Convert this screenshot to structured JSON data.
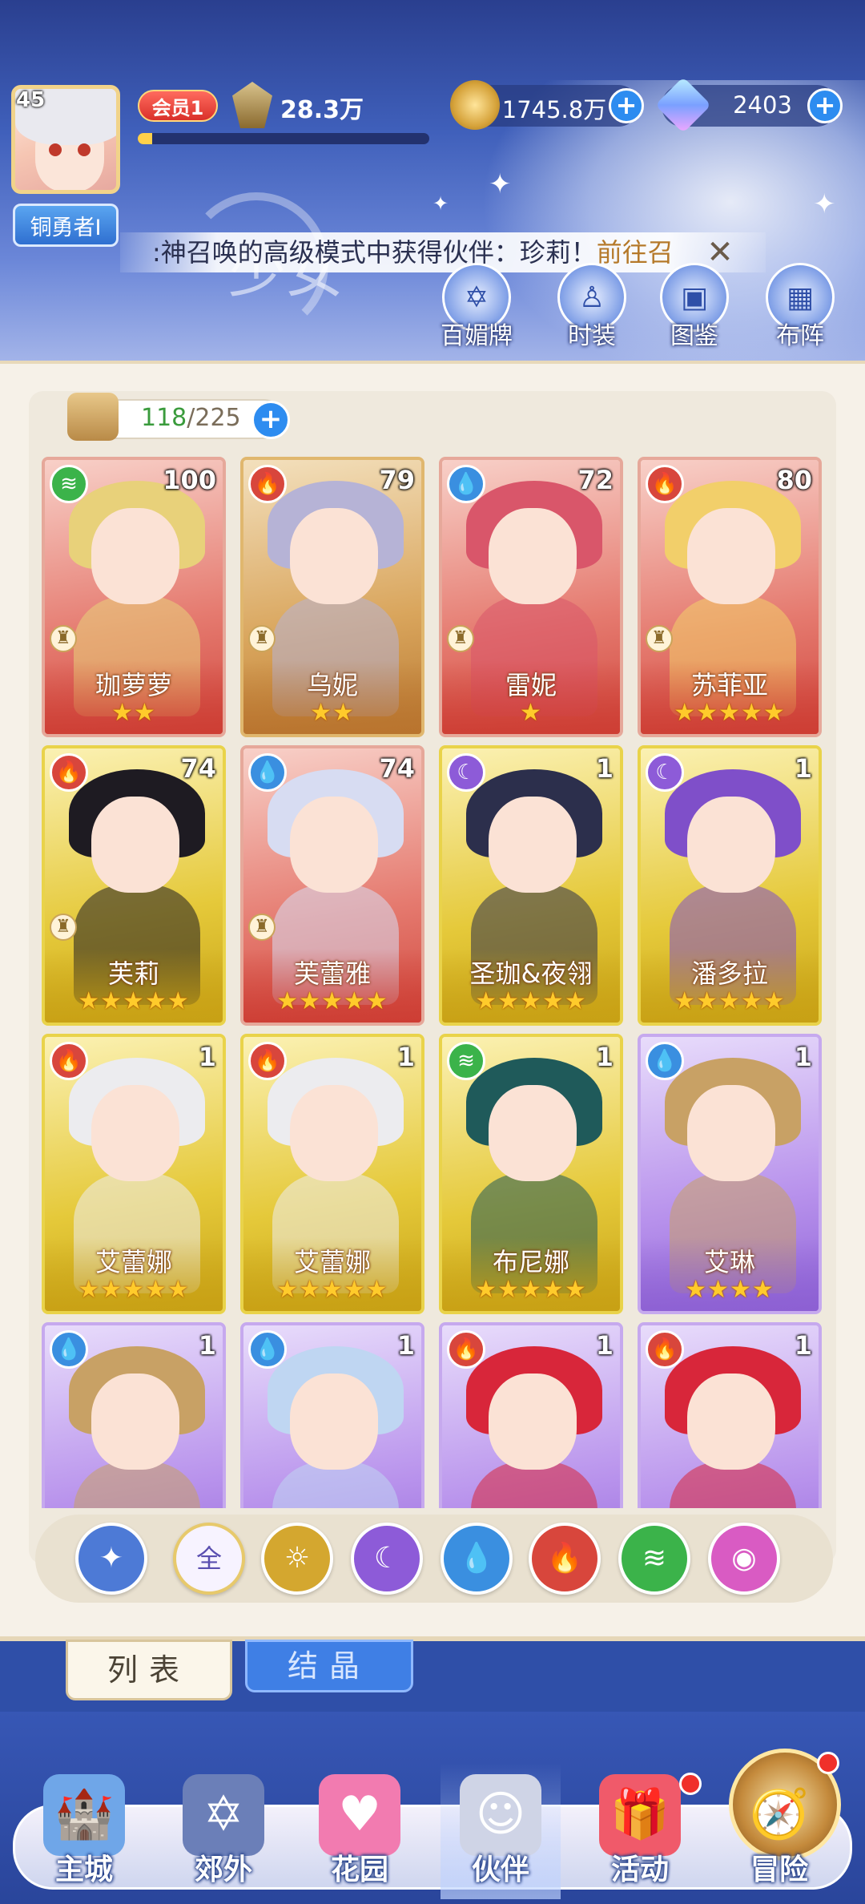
{
  "player": {
    "level": "45",
    "rank": "铜勇者I",
    "vip": "会员1",
    "power": "28.3万",
    "xp_progress": 0.05
  },
  "resources": {
    "gold": "1745.8万",
    "gems": "2403",
    "plus": "+"
  },
  "marquee": {
    "text": ":神召唤的高级模式中获得伙伴：珍莉！",
    "link": "前往召",
    "close": "✕"
  },
  "header_background_text": "少女",
  "header_buttons": [
    {
      "label": "百媚牌",
      "icon": "star-of-david-icon"
    },
    {
      "label": "时装",
      "icon": "outfit-icon"
    },
    {
      "label": "图鉴",
      "icon": "book-icon"
    },
    {
      "label": "布阵",
      "icon": "grid-icon"
    }
  ],
  "collection": {
    "current": "118",
    "separator": "/",
    "total": "225"
  },
  "cards": [
    {
      "name": "珈萝萝",
      "level": "100",
      "element": "wind",
      "rarity": "red",
      "stars": "★★",
      "rook": true,
      "hair": "#e8d17a"
    },
    {
      "name": "乌妮",
      "level": "79",
      "element": "fire",
      "rarity": "orange",
      "stars": "★★",
      "rook": true,
      "hair": "#b6b3d6"
    },
    {
      "name": "雷妮",
      "level": "72",
      "element": "water",
      "rarity": "red",
      "stars": "★",
      "rook": true,
      "hair": "#d9566a"
    },
    {
      "name": "苏菲亚",
      "level": "80",
      "element": "fire",
      "rarity": "red",
      "stars": "★★★★★",
      "rook": true,
      "hair": "#f2cf6a"
    },
    {
      "name": "芙莉",
      "level": "74",
      "element": "fire",
      "rarity": "gold",
      "stars": "★★★★★",
      "rook": true,
      "hair": "#1e1b22"
    },
    {
      "name": "芙蕾雅",
      "level": "74",
      "element": "water",
      "rarity": "red",
      "stars": "★★★★★",
      "rook": true,
      "hair": "#d7dcf2"
    },
    {
      "name": "圣珈&夜翎",
      "level": "1",
      "element": "moon",
      "rarity": "gold",
      "stars": "★★★★★",
      "rook": false,
      "hair": "#2c2f4c"
    },
    {
      "name": "潘多拉",
      "level": "1",
      "element": "moon",
      "rarity": "gold",
      "stars": "★★★★★",
      "rook": false,
      "hair": "#7f4fc9"
    },
    {
      "name": "艾蕾娜",
      "level": "1",
      "element": "fire",
      "rarity": "gold",
      "stars": "★★★★★",
      "rook": false,
      "hair": "#ececef"
    },
    {
      "name": "艾蕾娜",
      "level": "1",
      "element": "fire",
      "rarity": "gold",
      "stars": "★★★★★",
      "rook": false,
      "hair": "#ececef"
    },
    {
      "name": "布尼娜",
      "level": "1",
      "element": "wind",
      "rarity": "gold",
      "stars": "★★★★★",
      "rook": false,
      "hair": "#1f5a5a"
    },
    {
      "name": "艾琳",
      "level": "1",
      "element": "water",
      "rarity": "purple",
      "stars": "★★★★",
      "rook": false,
      "hair": "#c8a165"
    },
    {
      "name": "",
      "level": "1",
      "element": "water",
      "rarity": "purple",
      "stars": "",
      "rook": false,
      "hair": "#c8a165"
    },
    {
      "name": "",
      "level": "1",
      "element": "water",
      "rarity": "purple",
      "stars": "",
      "rook": false,
      "hair": "#bfd6f2"
    },
    {
      "name": "",
      "level": "1",
      "element": "fire",
      "rarity": "purple",
      "stars": "",
      "rook": false,
      "hair": "#d8263a"
    },
    {
      "name": "",
      "level": "1",
      "element": "fire",
      "rarity": "purple",
      "stars": "",
      "rook": false,
      "hair": "#d8263a"
    }
  ],
  "filters": [
    {
      "key": "special",
      "glyph": "✦",
      "color": "#4d7ad6"
    },
    {
      "key": "all",
      "glyph": "全",
      "color": "#f7f3ff"
    },
    {
      "key": "light",
      "glyph": "☼",
      "color": "#d4a72f"
    },
    {
      "key": "moon",
      "glyph": "☾",
      "color": "#8d5bd8"
    },
    {
      "key": "water",
      "glyph": "💧",
      "color": "#3a8fe0"
    },
    {
      "key": "fire",
      "glyph": "🔥",
      "color": "#d8463c"
    },
    {
      "key": "wind",
      "glyph": "≋",
      "color": "#3bb34a"
    },
    {
      "key": "arcane",
      "glyph": "◉",
      "color": "#d95bc3"
    }
  ],
  "tabs": {
    "list": "列表",
    "crystal": "结晶"
  },
  "nav": [
    {
      "label": "主城",
      "icon": "castle-icon",
      "color": "#6fa6e8",
      "badge": false
    },
    {
      "label": "郊外",
      "icon": "portal-icon",
      "color": "#6b7fb8",
      "badge": false
    },
    {
      "label": "花园",
      "icon": "heart-icon",
      "color": "#f27bb0",
      "badge": false
    },
    {
      "label": "伙伴",
      "icon": "partner-icon",
      "color": "#cfd4e6",
      "badge": false
    },
    {
      "label": "活动",
      "icon": "gift-icon",
      "color": "#f05a6a",
      "badge": true
    },
    {
      "label": "冒险",
      "icon": "compass-icon",
      "color": "#c48a3c",
      "badge": true
    }
  ],
  "element_glyphs": {
    "wind": "≋",
    "fire": "🔥",
    "water": "💧",
    "moon": "☾"
  }
}
